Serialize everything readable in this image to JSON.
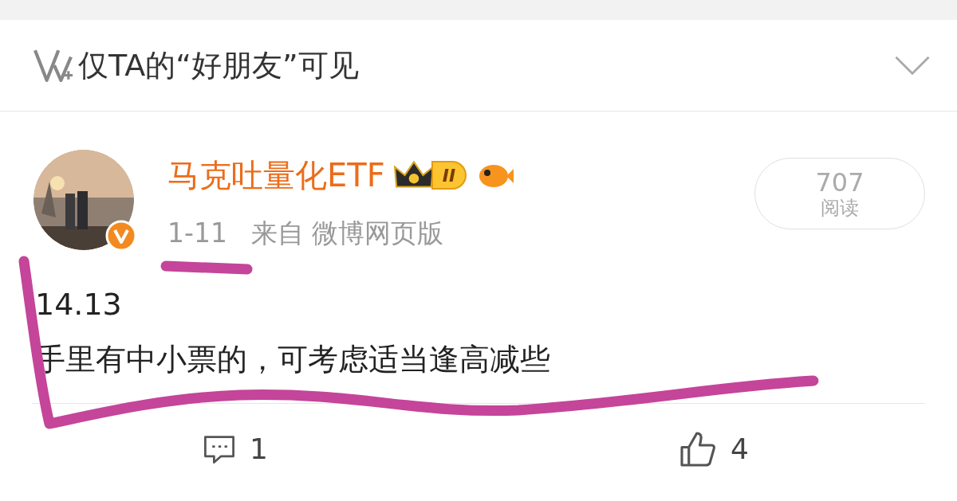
{
  "visibility": {
    "text": "仅TA的“好朋友”可见"
  },
  "post": {
    "author": "马克吐量化ETF",
    "level_badge": "II",
    "verified": true,
    "time": "1-11",
    "source": "来自 微博网页版",
    "reads": {
      "count": "707",
      "label": "阅读"
    },
    "lines": [
      "14.13",
      "手里有中小票的，可考虑适当逢高减些"
    ],
    "actions": [
      {
        "kind": "comment",
        "count": "1"
      },
      {
        "kind": "like",
        "count": "4"
      }
    ]
  }
}
